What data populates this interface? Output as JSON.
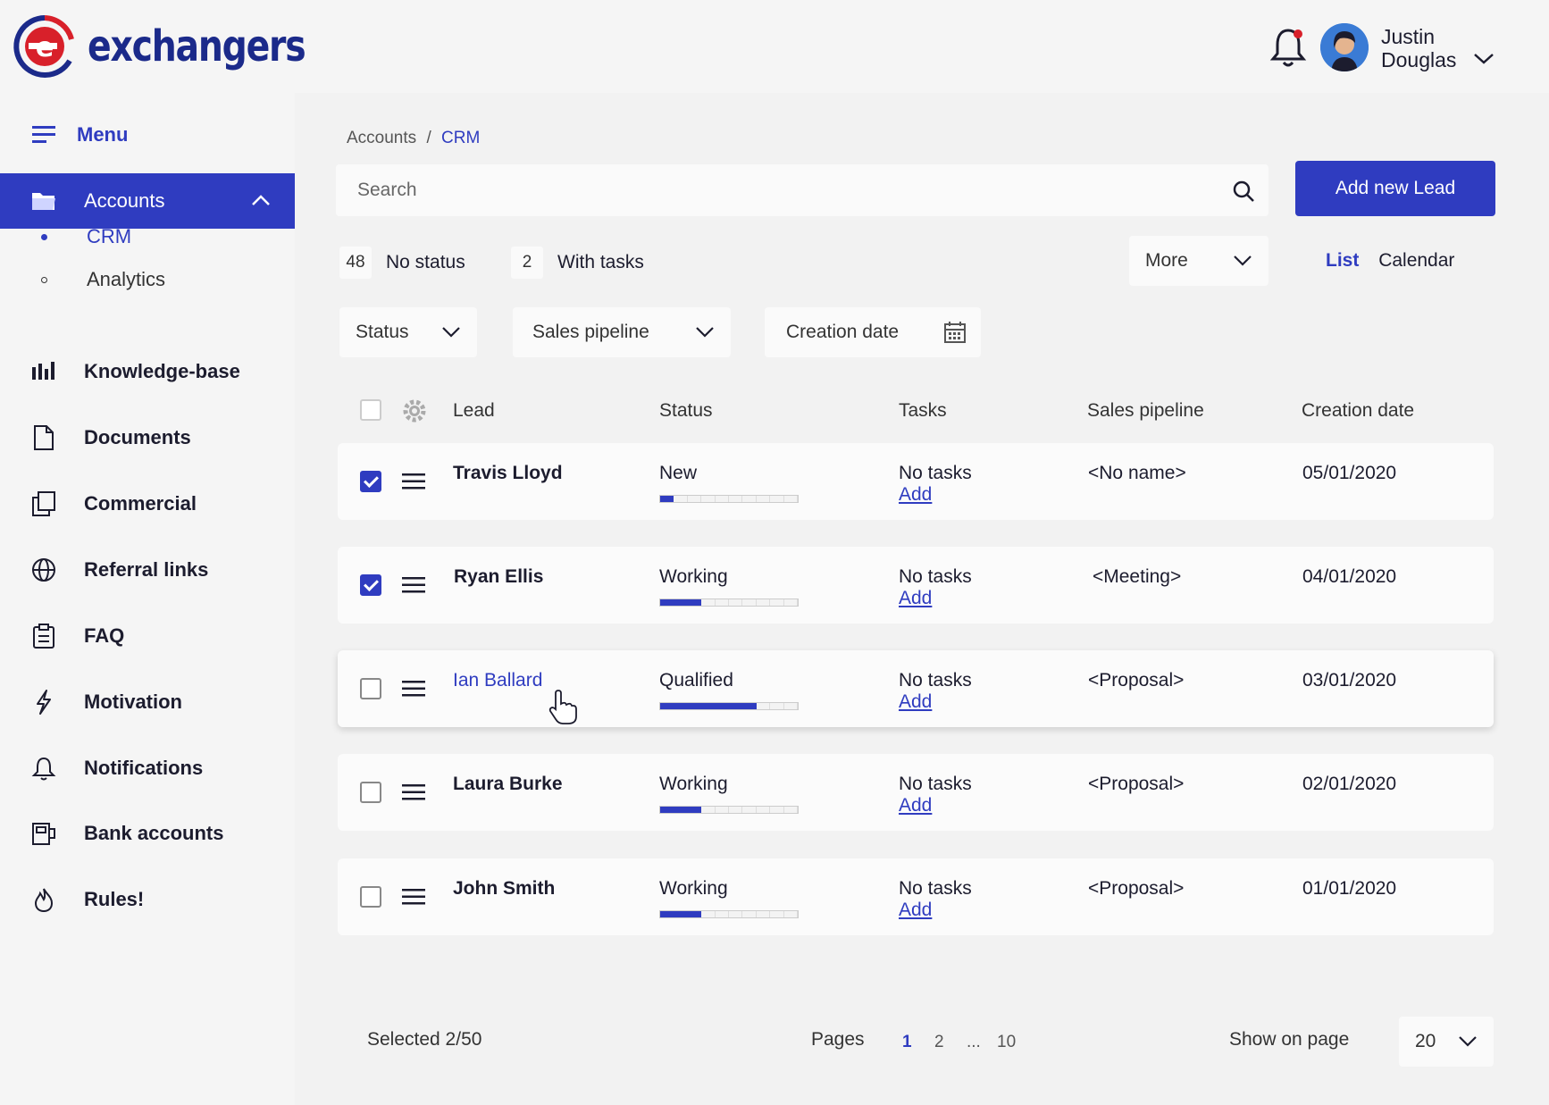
{
  "brand": {
    "name": "exchangers"
  },
  "user": {
    "first": "Justin",
    "last": "Douglas"
  },
  "sidebar": {
    "menu_label": "Menu",
    "active": {
      "label": "Accounts"
    },
    "sub_items": [
      {
        "label": "CRM",
        "active": true
      },
      {
        "label": "Analytics",
        "active": false
      }
    ],
    "items": [
      {
        "label": "Knowledge-base",
        "icon": "bar-chart-icon"
      },
      {
        "label": "Documents",
        "icon": "document-icon"
      },
      {
        "label": "Commercial",
        "icon": "copy-icon"
      },
      {
        "label": "Referral links",
        "icon": "globe-icon"
      },
      {
        "label": "FAQ",
        "icon": "clipboard-icon"
      },
      {
        "label": "Motivation",
        "icon": "lightning-icon"
      },
      {
        "label": "Notifications",
        "icon": "bell-icon"
      },
      {
        "label": "Bank accounts",
        "icon": "bank-icon"
      },
      {
        "label": "Rules!",
        "icon": "flame-icon"
      }
    ]
  },
  "breadcrumb": {
    "parent": "Accounts",
    "separator": "/",
    "current": "CRM"
  },
  "search": {
    "placeholder": "Search"
  },
  "actions": {
    "add_lead": "Add new Lead"
  },
  "counters": [
    {
      "count": "48",
      "label": "No status"
    },
    {
      "count": "2",
      "label": "With tasks"
    }
  ],
  "more": {
    "label": "More"
  },
  "view": {
    "list": "List",
    "calendar": "Calendar"
  },
  "filters": {
    "status": "Status",
    "pipeline": "Sales pipeline",
    "date": "Creation date"
  },
  "table": {
    "headers": {
      "lead": "Lead",
      "status": "Status",
      "tasks": "Tasks",
      "pipeline": "Sales pipeline",
      "date": "Creation date"
    },
    "rows": [
      {
        "lead": "Travis Lloyd",
        "status": "New",
        "progress": 0.1,
        "tasks": "No tasks",
        "add": "Add",
        "pipeline": "<No name>",
        "date": "05/01/2020",
        "checked": true
      },
      {
        "lead": "Ryan Ellis",
        "status": "Working",
        "progress": 0.3,
        "tasks": "No tasks",
        "add": "Add",
        "pipeline": "<Meeting>",
        "date": "04/01/2020",
        "checked": true
      },
      {
        "lead": "Ian Ballard",
        "status": "Qualified",
        "progress": 0.7,
        "tasks": "No tasks",
        "add": "Add",
        "pipeline": "<Proposal>",
        "date": "03/01/2020",
        "checked": false
      },
      {
        "lead": "Laura Burke",
        "status": "Working",
        "progress": 0.3,
        "tasks": "No tasks",
        "add": "Add",
        "pipeline": "<Proposal>",
        "date": "02/01/2020",
        "checked": false
      },
      {
        "lead": "John Smith",
        "status": "Working",
        "progress": 0.3,
        "tasks": "No tasks",
        "add": "Add",
        "pipeline": "<Proposal>",
        "date": "01/01/2020",
        "checked": false
      }
    ]
  },
  "footer": {
    "selected": "Selected 2/50",
    "pages_label": "Pages",
    "pages": [
      "1",
      "2",
      "...",
      "10"
    ],
    "current_page": "1",
    "show_label": "Show on page",
    "per_page": "20"
  },
  "colors": {
    "accent": "#2f3cc0",
    "brand_red": "#d8202a",
    "brand_blue": "#1b2a8a"
  }
}
